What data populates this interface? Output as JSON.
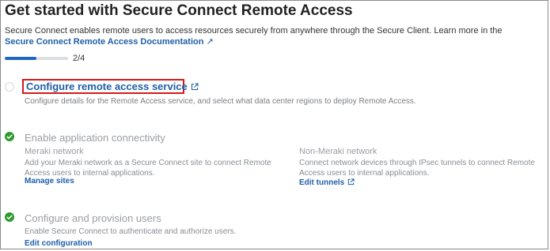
{
  "header": {
    "title": "Get started with Secure Connect Remote Access",
    "intro": "Secure Connect enables remote users to access resources securely from anywhere through the Secure Client. Learn more in the",
    "doc_link": "Secure Connect Remote Access Documentation",
    "doc_link_arrow": "↗"
  },
  "progress": {
    "label": "2/4",
    "fraction": 0.5
  },
  "steps": [
    {
      "title": "Configure remote access service",
      "description": "Configure details for the Remote Access service, and select what data center regions to deploy Remote Access.",
      "status": "pending",
      "highlighted": true
    },
    {
      "title": "Enable application connectivity",
      "status": "complete",
      "columns": [
        {
          "title": "Meraki network",
          "description": "Add your Meraki network as a Secure Connect site to connect Remote Access users to internal applications.",
          "link": "Manage sites"
        },
        {
          "title": "Non-Meraki network",
          "description": "Connect network devices through IPsec tunnels to connect Remote Access users to internal applications.",
          "link": "Edit tunnels"
        }
      ]
    },
    {
      "title": "Configure and provision users",
      "description": "Enable Secure Connect to authenticate and authorize users.",
      "link": "Edit configuration",
      "status": "complete"
    }
  ],
  "colors": {
    "link": "#1f5fa8",
    "progress_fill": "#1f66c0",
    "check_green": "#2f9a2f",
    "highlight_red": "#d31a1a"
  },
  "icons": {
    "external_link": "external-link-icon",
    "check": "checkmark-icon"
  }
}
